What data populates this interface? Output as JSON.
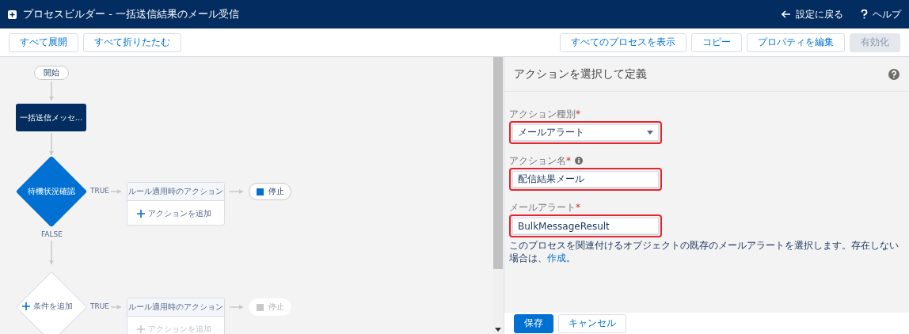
{
  "header": {
    "title": "プロセスビルダー - 一括送信結果のメール受信",
    "links": [
      {
        "kind": "back",
        "label": "設定に戻る"
      },
      {
        "kind": "help",
        "label": "ヘルプ"
      }
    ]
  },
  "toolbar": {
    "left": [
      {
        "label": "すべて展開",
        "disabled": false
      },
      {
        "label": "すべて折りたたむ",
        "disabled": false
      }
    ],
    "right": [
      {
        "label": "すべてのプロセスを表示",
        "disabled": false
      },
      {
        "label": "コピー",
        "disabled": false
      },
      {
        "label": "プロパティを編集",
        "disabled": false
      },
      {
        "label": "有効化",
        "disabled": true
      }
    ]
  },
  "flow": {
    "start": "開始",
    "object_node": "一括送信メッセ...",
    "false_label": "FALSE",
    "criteria": [
      {
        "kind": "criteria",
        "label": "待機状況確認",
        "true_label": "TRUE",
        "action_header": "ルール適用時のアクション",
        "add_action": "アクションを追加",
        "stop": "停止",
        "disabled": false
      },
      {
        "kind": "add",
        "label": "条件を追加",
        "true_label": "TRUE",
        "action_header": "ルール適用時のアクション",
        "add_action": "アクションを追加",
        "stop": "停止",
        "disabled": true
      }
    ]
  },
  "panel": {
    "title": "アクションを選択して定義",
    "fields": [
      {
        "kind": "select",
        "label": "アクション種別",
        "required_mark": "*",
        "info": false,
        "value": "メールアラート",
        "highlighted": true
      },
      {
        "kind": "text",
        "label": "アクション名",
        "required_mark": "*",
        "info": true,
        "value": "配信結果メール",
        "highlighted": true
      },
      {
        "kind": "text",
        "label": "メールアラート",
        "required_mark": "*",
        "info": false,
        "value": "BulkMessageResult",
        "highlighted": true
      }
    ],
    "help_text": "このプロセスを関連付けるオブジェクトの既存のメールアラートを選択します。存在しない場合は、",
    "help_link": "作成",
    "help_end": "。",
    "buttons": [
      {
        "label": "保存",
        "kind": "primary"
      },
      {
        "label": "キャンセル",
        "kind": "neutral"
      }
    ]
  }
}
